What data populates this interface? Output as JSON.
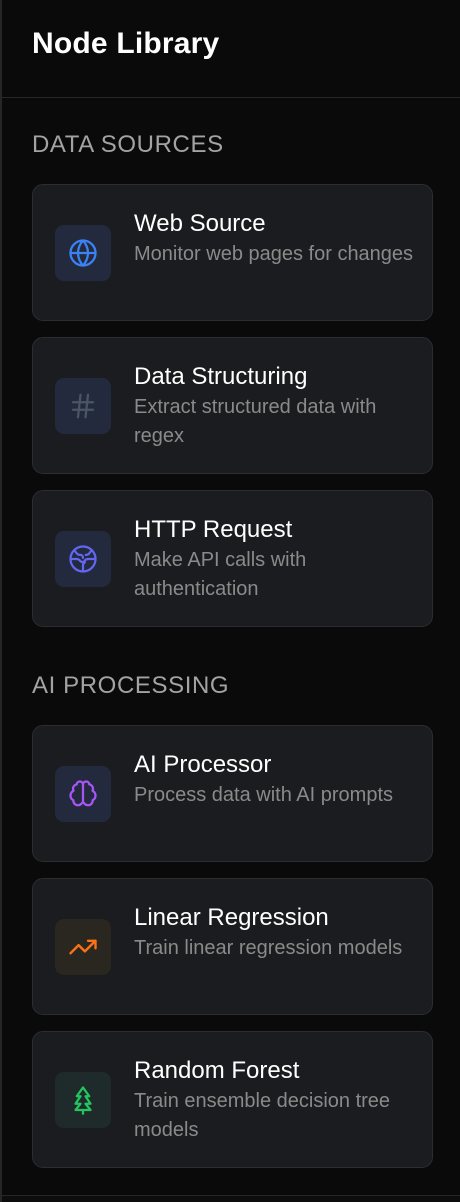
{
  "header": {
    "title": "Node Library"
  },
  "sections": [
    {
      "title": "DATA SOURCES",
      "items": [
        {
          "title": "Web Source",
          "description": "Monitor web pages for changes",
          "icon": "globe-icon",
          "color": "#3b82f6"
        },
        {
          "title": "Data Structuring",
          "description": "Extract structured data with regex",
          "icon": "hash-icon",
          "color": "#4b5563"
        },
        {
          "title": "HTTP Request",
          "description": "Make API calls with authentication",
          "icon": "network-globe-icon",
          "color": "#6366f1"
        }
      ]
    },
    {
      "title": "AI PROCESSING",
      "items": [
        {
          "title": "AI Processor",
          "description": "Process data with AI prompts",
          "icon": "brain-icon",
          "color": "#a855f7"
        },
        {
          "title": "Linear Regression",
          "description": "Train linear regression models",
          "icon": "trending-up-icon",
          "color": "#f97316"
        },
        {
          "title": "Random Forest",
          "description": "Train ensemble decision tree models",
          "icon": "tree-icon",
          "color": "#22c55e"
        }
      ]
    }
  ]
}
